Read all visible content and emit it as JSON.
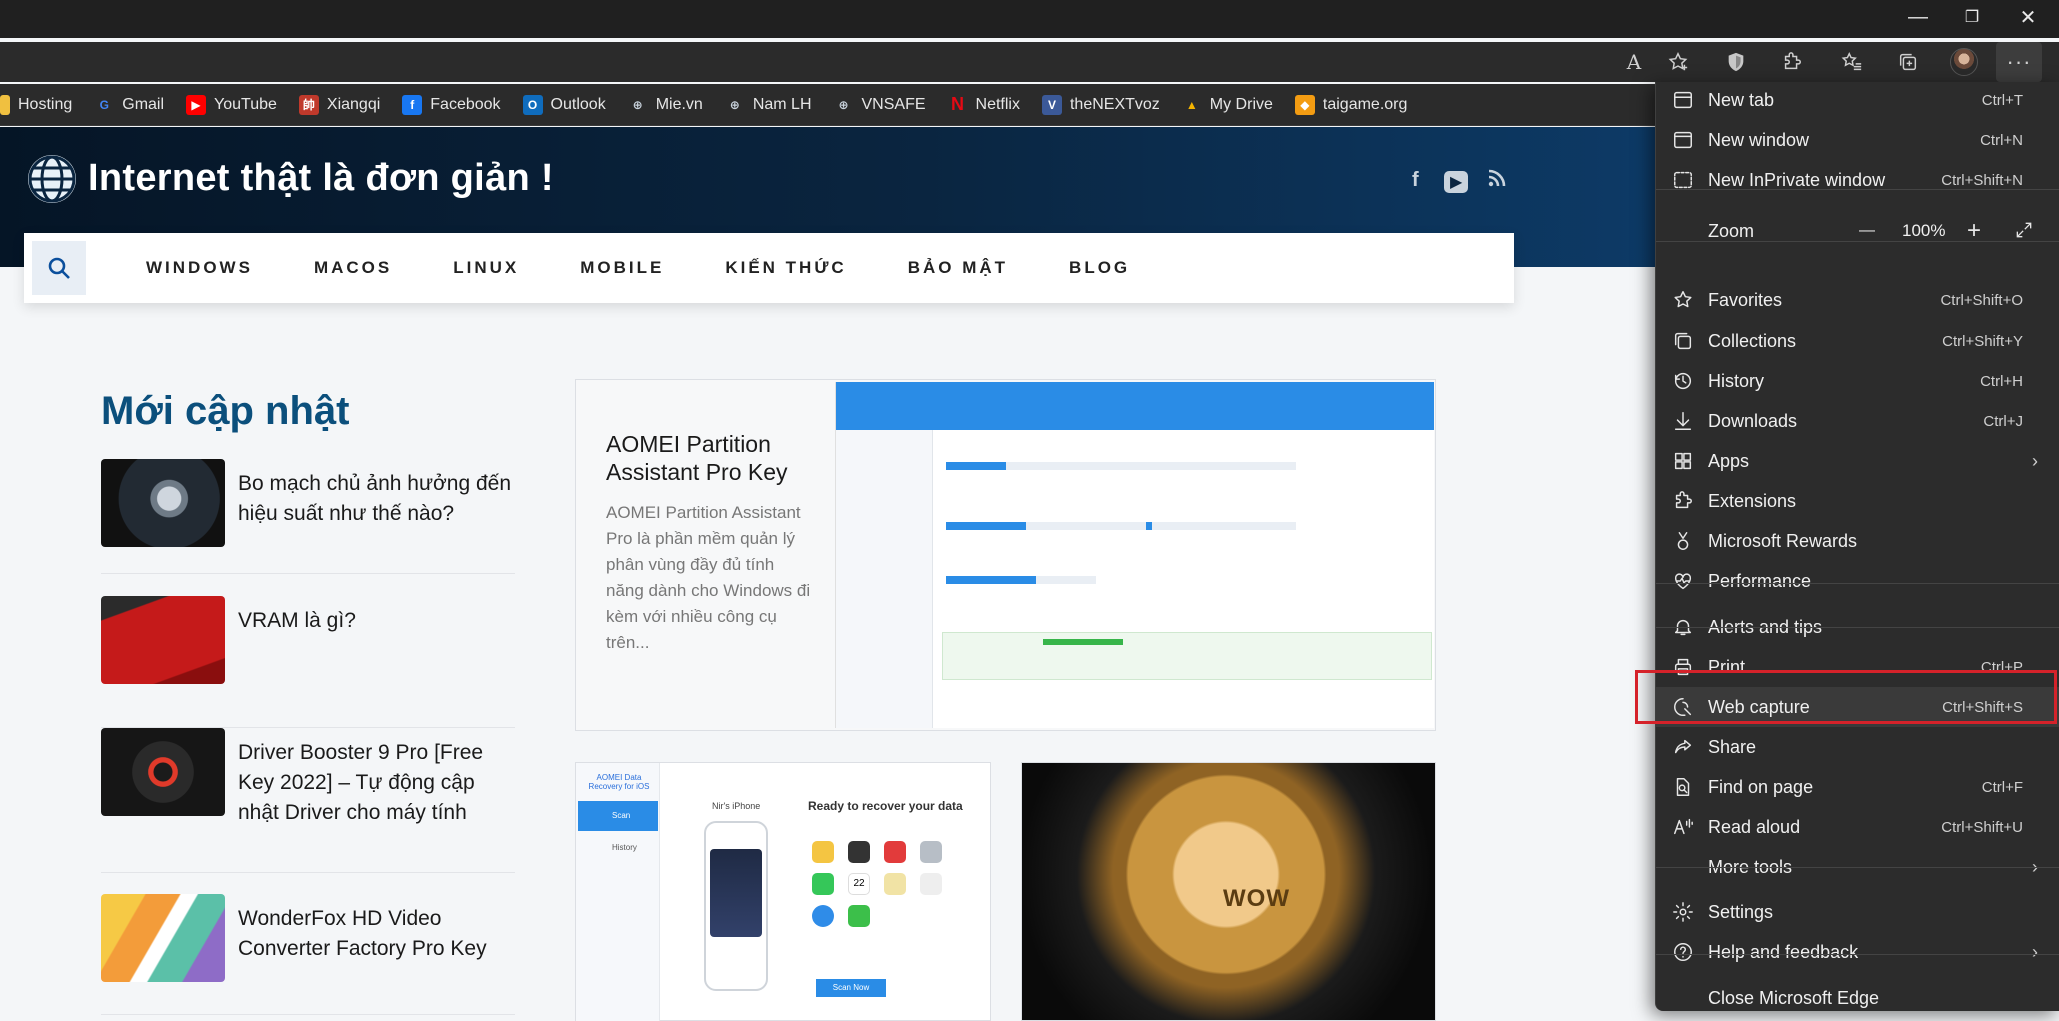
{
  "window": {
    "min": "—",
    "restore": "❐",
    "close": "✕"
  },
  "toolbar": {
    "read_aloud_label": "A",
    "more_label": "···"
  },
  "bookmarks": [
    {
      "label": "Hosting",
      "icon": "folder-icon",
      "color": "#f0c040"
    },
    {
      "label": "Gmail",
      "icon": "google-icon",
      "color": "#ffffff"
    },
    {
      "label": "YouTube",
      "icon": "youtube-icon",
      "color": "#ff0000"
    },
    {
      "label": "Xiangqi",
      "icon": "xiangqi-icon",
      "color": "#c0392b"
    },
    {
      "label": "Facebook",
      "icon": "facebook-icon",
      "color": "#1877f2"
    },
    {
      "label": "Outlook",
      "icon": "outlook-icon",
      "color": "#0f6cbd"
    },
    {
      "label": "Mie.vn",
      "icon": "globe-icon",
      "color": "#6b7a8a"
    },
    {
      "label": "Nam LH",
      "icon": "globe-icon",
      "color": "#6b7a8a"
    },
    {
      "label": "VNSAFE",
      "icon": "globe-icon",
      "color": "#6b7a8a"
    },
    {
      "label": "Netflix",
      "icon": "netflix-icon",
      "color": "#e50914"
    },
    {
      "label": "theNEXTvoz",
      "icon": "vbulletin-icon",
      "color": "#3b5998"
    },
    {
      "label": "My Drive",
      "icon": "drive-icon",
      "color": "#34a853"
    },
    {
      "label": "taigame.org",
      "icon": "taigame-icon",
      "color": "#f39c12"
    }
  ],
  "site": {
    "title": "Internet thật là đơn giản !",
    "social": [
      "f",
      "▶",
      "⟟"
    ],
    "nav": [
      "WINDOWS",
      "MACOS",
      "LINUX",
      "MOBILE",
      "KIẾN THỨC",
      "BẢO MẬT",
      "BLOG"
    ],
    "section_title": "Mới cập nhật",
    "articles": [
      {
        "title": "Bo mạch chủ ảnh hưởng đến hiệu suất như thế nào?"
      },
      {
        "title": "VRAM là gì?"
      },
      {
        "title": "Driver Booster 9 Pro [Free Key 2022] – Tự động cập nhật Driver cho máy tính"
      },
      {
        "title": "WonderFox HD Video Converter Factory Pro Key"
      }
    ],
    "featured": {
      "title": "AOMEI Partition Assistant Pro Key",
      "excerpt": "AOMEI Partition Assistant Pro là phần mềm quản lý phân vùng đầy đủ tính năng dành cho Windows đi kèm với nhiều công cụ trên..."
    },
    "card2": {
      "heading": "Ready to recover your data",
      "phone": "Nir's iPhone",
      "scan_btn": "Scan Now",
      "side": [
        "Scan",
        "History"
      ],
      "app_name": "AOMEI Data Recovery for iOS",
      "calendar_day": "22"
    },
    "card3": {
      "coin_text": "WOW"
    }
  },
  "menu": {
    "items": [
      {
        "label": "New tab",
        "shortcut": "Ctrl+T",
        "icon": "new-tab-icon"
      },
      {
        "label": "New window",
        "shortcut": "Ctrl+N",
        "icon": "new-window-icon"
      },
      {
        "label": "New InPrivate window",
        "shortcut": "Ctrl+Shift+N",
        "icon": "inprivate-icon"
      },
      {
        "label": "Favorites",
        "shortcut": "Ctrl+Shift+O",
        "icon": "favorites-icon"
      },
      {
        "label": "Collections",
        "shortcut": "Ctrl+Shift+Y",
        "icon": "collections-icon"
      },
      {
        "label": "History",
        "shortcut": "Ctrl+H",
        "icon": "history-icon"
      },
      {
        "label": "Downloads",
        "shortcut": "Ctrl+J",
        "icon": "downloads-icon"
      },
      {
        "label": "Apps",
        "shortcut": "",
        "icon": "apps-icon"
      },
      {
        "label": "Extensions",
        "shortcut": "",
        "icon": "extensions-icon"
      },
      {
        "label": "Microsoft Rewards",
        "shortcut": "",
        "icon": "rewards-icon"
      },
      {
        "label": "Performance",
        "shortcut": "",
        "icon": "performance-icon"
      },
      {
        "label": "Alerts and tips",
        "shortcut": "",
        "icon": "bell-icon"
      },
      {
        "label": "Print",
        "shortcut": "Ctrl+P",
        "icon": "print-icon"
      },
      {
        "label": "Web capture",
        "shortcut": "Ctrl+Shift+S",
        "icon": "web-capture-icon"
      },
      {
        "label": "Share",
        "shortcut": "",
        "icon": "share-icon"
      },
      {
        "label": "Find on page",
        "shortcut": "Ctrl+F",
        "icon": "find-icon"
      },
      {
        "label": "Read aloud",
        "shortcut": "Ctrl+Shift+U",
        "icon": "read-aloud-icon"
      },
      {
        "label": "More tools",
        "shortcut": "",
        "icon": ""
      },
      {
        "label": "Settings",
        "shortcut": "",
        "icon": "settings-icon"
      },
      {
        "label": "Help and feedback",
        "shortcut": "",
        "icon": "help-icon"
      },
      {
        "label": "Close Microsoft Edge",
        "shortcut": "",
        "icon": ""
      }
    ],
    "zoom": {
      "label": "Zoom",
      "value": "100%",
      "minus": "—",
      "plus": "+"
    }
  }
}
